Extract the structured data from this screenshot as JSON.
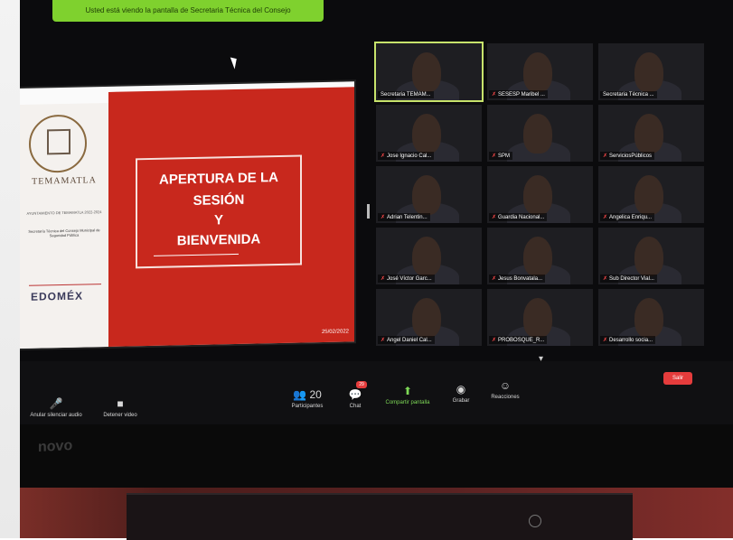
{
  "notice": "Usted está viendo la pantalla de Secretaria Técnica del Consejo",
  "slide": {
    "org_name": "TEMAMATLA",
    "small1": "AYUNTAMIENTO DE TEMAMATLA 2022-2024",
    "small2": "Secretaría Técnica del Consejo Municipal de Seguridad Pública",
    "brand": "EDOMÉX",
    "title_lines": [
      "APERTURA DE LA",
      "SESIÓN",
      "Y",
      "BIENVENIDA"
    ],
    "date": "25/02/2022"
  },
  "participants": [
    {
      "name": "Secretaria TEMAM..."
    },
    {
      "name": "SESESP Maribel ..."
    },
    {
      "name": "Secretaria Técnica ..."
    },
    {
      "name": "Jose Ignacio Cal..."
    },
    {
      "name": "SPM"
    },
    {
      "name": "ServiciosPúblicos"
    },
    {
      "name": "Adrian Telentin..."
    },
    {
      "name": "Guardia Nacional..."
    },
    {
      "name": "Angelica Enriqu..."
    },
    {
      "name": "José Víctor Garc..."
    },
    {
      "name": "Jesus Bonvatala..."
    },
    {
      "name": "Sub Director Vial..."
    },
    {
      "name": "Angel Daniel Cal..."
    },
    {
      "name": "PROBOSQUE_R..."
    },
    {
      "name": "Desarrollo socia..."
    }
  ],
  "toolbar": {
    "mute": "Anular silenciar audio",
    "video": "Detener video",
    "participants": "Participantes",
    "participants_count": "20",
    "chat": "Chat",
    "chat_badge": "29",
    "share": "Compartir pantalla",
    "record": "Grabar",
    "reactions": "Reacciones",
    "leave": "Salir"
  },
  "monitor_brand": "novo"
}
